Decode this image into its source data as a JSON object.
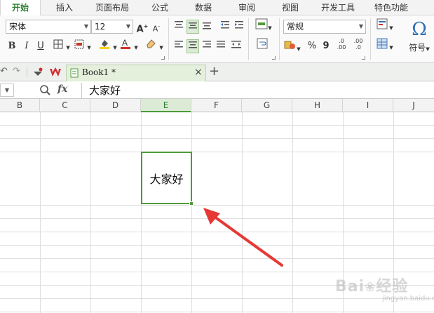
{
  "menu": {
    "tabs": [
      "开始",
      "插入",
      "页面布局",
      "公式",
      "数据",
      "审阅",
      "视图",
      "开发工具",
      "特色功能"
    ],
    "active_tab": "开始"
  },
  "ribbon": {
    "font_name": "宋体",
    "font_size": "12",
    "grow_font": "A",
    "shrink_font": "A",
    "bold": "B",
    "italic": "I",
    "underline": "U",
    "number_format": "常规",
    "percent": "%",
    "comma": "9",
    "increase_decimal": ".0 .00",
    "decrease_decimal": ".00 .0",
    "symbol_glyph": "Ω",
    "symbol_label": "符号",
    "font_color": "#d32f2f",
    "fill_color": "#f5d400"
  },
  "tabbar": {
    "doc_title": "Book1 *",
    "close": "×",
    "new_tab": "+"
  },
  "formula_bar": {
    "fx_label": "fx",
    "content": "大家好"
  },
  "sheet": {
    "columns": [
      "B",
      "C",
      "D",
      "E",
      "F",
      "G",
      "H",
      "I",
      "J"
    ],
    "selected_column": "E",
    "selected_cell_value": "大家好"
  },
  "watermark": {
    "brand": "Bai",
    "brand2": "经验",
    "sub": "jingyan.baidu.com"
  }
}
